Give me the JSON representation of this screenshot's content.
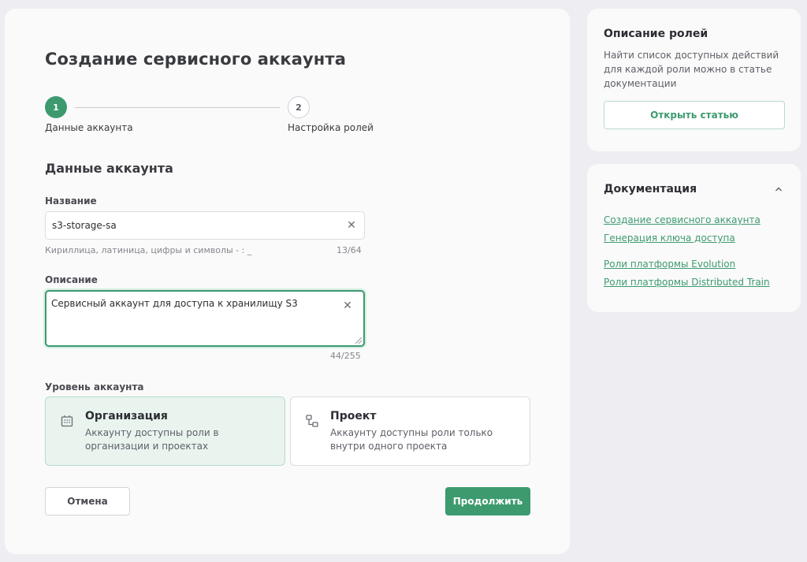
{
  "page": {
    "title": "Создание сервисного аккаунта"
  },
  "stepper": {
    "steps": [
      {
        "number": "1",
        "label": "Данные аккаунта",
        "state": "active"
      },
      {
        "number": "2",
        "label": "Настройка ролей",
        "state": "pending"
      }
    ]
  },
  "form": {
    "section_title": "Данные аккаунта",
    "name": {
      "label": "Название",
      "value": "s3-storage-sa",
      "hint": "Кириллица, латиница, цифры и символы - : _",
      "counter": "13/64"
    },
    "description": {
      "label": "Описание",
      "value": "Сервисный аккаунт для доступа к хранилищу S3",
      "counter": "44/255"
    },
    "level": {
      "label": "Уровень аккаунта",
      "options": [
        {
          "title": "Организация",
          "description": "Аккаунту доступны роли в организации и проектах",
          "selected": true,
          "icon": "building-icon"
        },
        {
          "title": "Проект",
          "description": "Аккаунту доступны роли только внутри одного проекта",
          "selected": false,
          "icon": "hierarchy-icon"
        }
      ]
    },
    "cancel_label": "Отмена",
    "continue_label": "Продолжить"
  },
  "roles_card": {
    "title": "Описание ролей",
    "text": "Найти список доступных действий для каждой роли можно в статье документации",
    "button_label": "Открыть статью"
  },
  "docs_card": {
    "title": "Документация",
    "links": [
      "Создание сервисного аккаунта",
      "Генерация ключа доступа",
      "Роли платформы Evolution",
      "Роли платформы Distributed Train"
    ]
  },
  "colors": {
    "accent": "#3d9a6f",
    "background": "#eeeef2",
    "card": "#fafafa",
    "selected_card": "#e9f4ef"
  }
}
